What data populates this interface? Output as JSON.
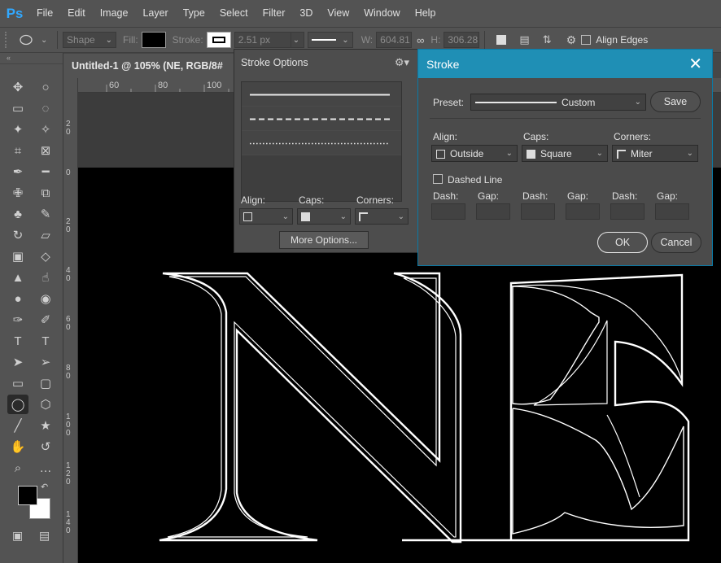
{
  "app": {
    "logo": "Ps"
  },
  "menu": [
    "File",
    "Edit",
    "Image",
    "Layer",
    "Type",
    "Select",
    "Filter",
    "3D",
    "View",
    "Window",
    "Help"
  ],
  "options_bar": {
    "tool_mode": "Shape",
    "fill_label": "Fill:",
    "stroke_label": "Stroke:",
    "stroke_width": "2.51 px",
    "w_label": "W:",
    "w_value": "604.81",
    "h_label": "H:",
    "h_value": "306.28",
    "align_edges_label": "Align Edges",
    "align_edges_checked": false,
    "fill_color": "#000000",
    "stroke_color": "#ffffff"
  },
  "document": {
    "tab_title": "Untitled-1 @ 105% (NE, RGB/8#"
  },
  "ruler": {
    "top_ticks": [
      "60",
      "80",
      "100"
    ],
    "left_ticks": [
      "20",
      "0",
      "20",
      "40",
      "60",
      "80",
      "100",
      "120",
      "140"
    ]
  },
  "stroke_options_panel": {
    "title": "Stroke Options",
    "presets": [
      "solid",
      "dashed",
      "dotted"
    ],
    "align_label": "Align:",
    "caps_label": "Caps:",
    "corners_label": "Corners:",
    "more_options_label": "More Options..."
  },
  "stroke_dialog": {
    "title": "Stroke",
    "preset_label": "Preset:",
    "preset_value": "Custom",
    "save_label": "Save",
    "align_label": "Align:",
    "align_value": "Outside",
    "caps_label": "Caps:",
    "caps_value": "Square",
    "corners_label": "Corners:",
    "corners_value": "Miter",
    "dashed_line_label": "Dashed Line",
    "dashed_line_checked": false,
    "dash_gap_labels": [
      "Dash:",
      "Gap:",
      "Dash:",
      "Gap:",
      "Dash:",
      "Gap:"
    ],
    "ok_label": "OK",
    "cancel_label": "Cancel",
    "title_color": "#1f8fb5"
  },
  "canvas_text": "NE"
}
